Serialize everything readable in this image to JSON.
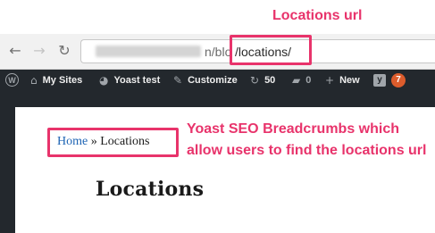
{
  "annotations": {
    "url_label": "Locations url",
    "breadcrumb_label": "Yoast SEO Breadcrumbs which allow users to find the locations url"
  },
  "browser": {
    "icons": {
      "back": "arrow-left-icon",
      "forward": "arrow-right-icon",
      "reload": "reload-icon"
    },
    "url_partial": "n/blo",
    "url_path": "/locations/"
  },
  "admin_bar": {
    "wp_logo_icon": "wordpress-logo-icon",
    "my_sites": "My Sites",
    "site_name": "Yoast test",
    "customize": "Customize",
    "updates_count": "50",
    "comments_count": "0",
    "new_label": "New",
    "yoast_badge": "7"
  },
  "page": {
    "breadcrumb": {
      "home": "Home",
      "separator": "»",
      "current": "Locations"
    },
    "title": "Locations"
  },
  "colors": {
    "annotation": "#e8336b",
    "admin_bar_bg": "#23282d",
    "breadcrumb_link": "#1e64b4",
    "yoast_badge": "#dc5c2c"
  }
}
